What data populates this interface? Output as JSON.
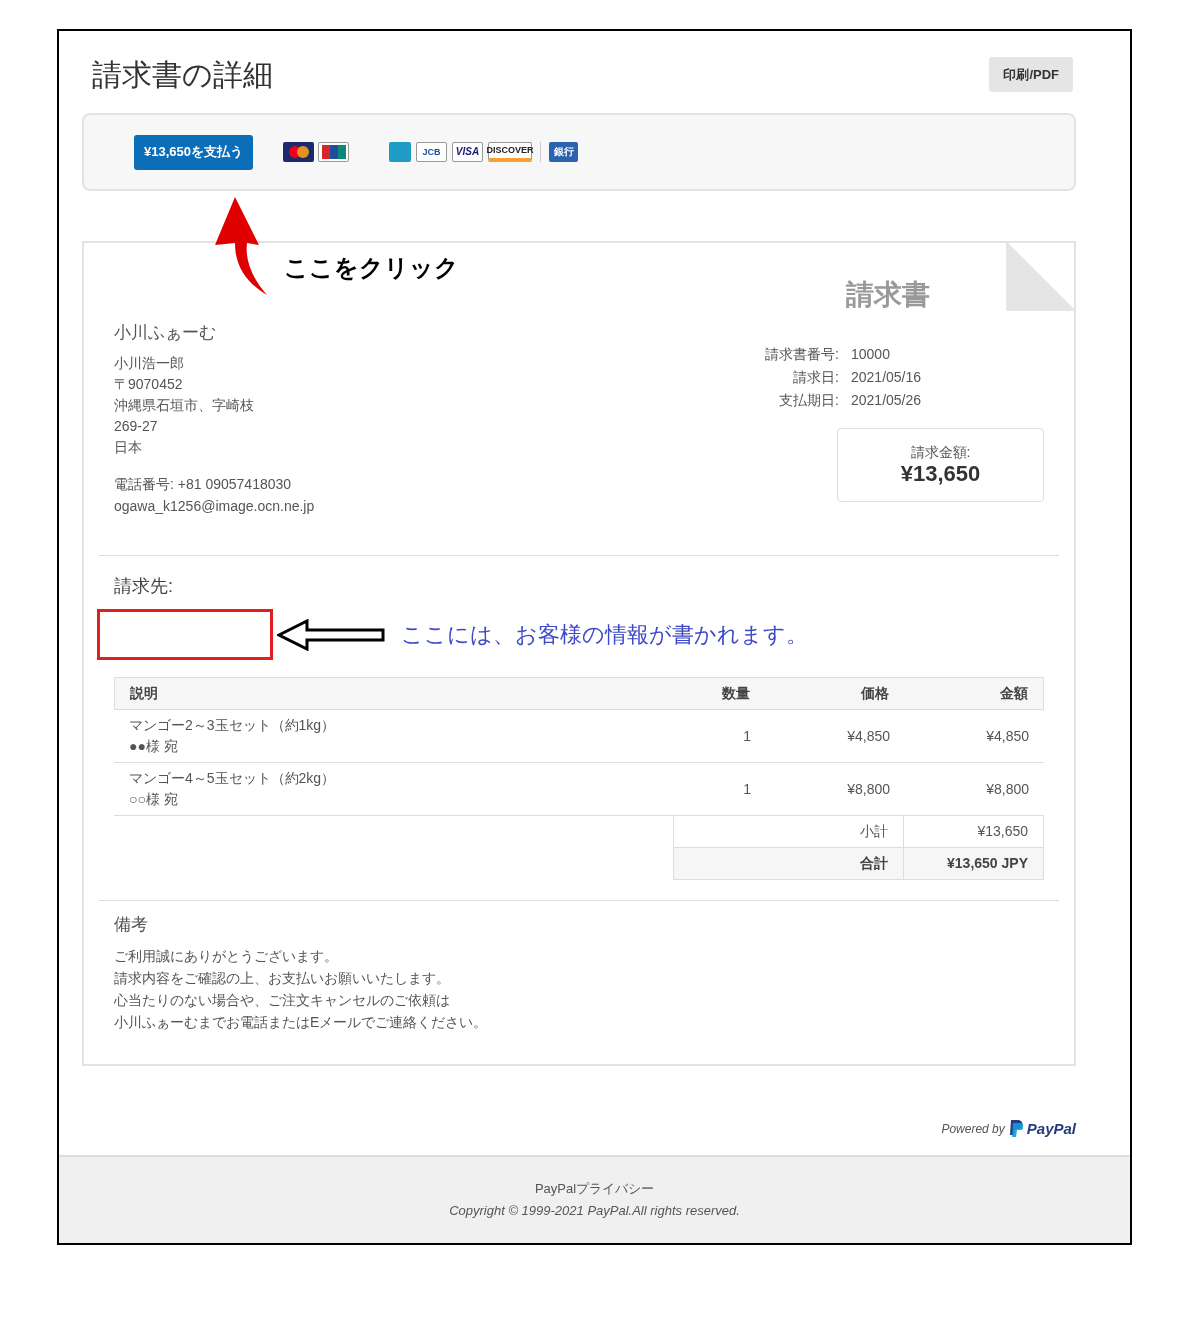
{
  "page": {
    "title": "請求書の詳細",
    "print_button": "印刷/PDF"
  },
  "payment": {
    "pay_button": "¥13,650を支払う",
    "method_groups": [
      [
        {
          "kind": "mastercard"
        },
        {
          "kind": "unionpay"
        }
      ],
      [
        {
          "kind": "amex"
        },
        {
          "kind": "jcb",
          "label": "JCB"
        },
        {
          "kind": "visa",
          "label": "VISA"
        },
        {
          "kind": "discover",
          "label": "DISCOVER"
        }
      ],
      [
        {
          "kind": "bank",
          "label": "銀行"
        }
      ]
    ]
  },
  "annotations": {
    "click_note": "ここをクリック",
    "customer_note": "ここには、お客様の情報が書かれます。"
  },
  "invoice": {
    "title": "請求書",
    "seller": {
      "name": "小川ふぁーむ",
      "lines": [
        "小川浩一郎",
        "〒9070452",
        "沖縄県石垣市、字崎枝",
        "269-27",
        "日本"
      ],
      "phone": "電話番号: +81 09057418030",
      "email": "ogawa_k1256@image.ocn.ne.jp"
    },
    "meta": [
      {
        "label": "請求書番号:",
        "value": "10000"
      },
      {
        "label": "請求日:",
        "value": "2021/05/16"
      },
      {
        "label": "支払期日:",
        "value": "2021/05/26"
      }
    ],
    "amount_due": {
      "label": "請求金額:",
      "value": "¥13,650"
    },
    "bill_to_label": "請求先:",
    "table": {
      "columns": [
        "説明",
        "数量",
        "価格",
        "金額"
      ],
      "rows": [
        {
          "description": "マンゴー2～3玉セット（約1kg）",
          "recipient": "●●様 宛",
          "qty": "1",
          "price": "¥4,850",
          "amount": "¥4,850"
        },
        {
          "description": "マンゴー4～5玉セット（約2kg）",
          "recipient": "○○様 宛",
          "qty": "1",
          "price": "¥8,800",
          "amount": "¥8,800"
        }
      ],
      "totals": [
        {
          "kind": "subtotal",
          "label": "小計",
          "value": "¥13,650"
        },
        {
          "kind": "total",
          "label": "合計",
          "value": "¥13,650 JPY"
        }
      ]
    },
    "notes": {
      "title": "備考",
      "lines": [
        "ご利用誠にありがとうございます。",
        "請求内容をご確認の上、お支払いお願いいたします。",
        "心当たりのない場合や、ご注文キャンセルのご依頼は",
        "小川ふぁーむまでお電話またはEメールでご連絡ください。"
      ]
    }
  },
  "powered_by": {
    "text": "Powered by",
    "brand": "PayPal"
  },
  "footer": {
    "link": "PayPalプライバシー",
    "copyright": "Copyright © 1999-2021 PayPal.All rights reserved."
  }
}
